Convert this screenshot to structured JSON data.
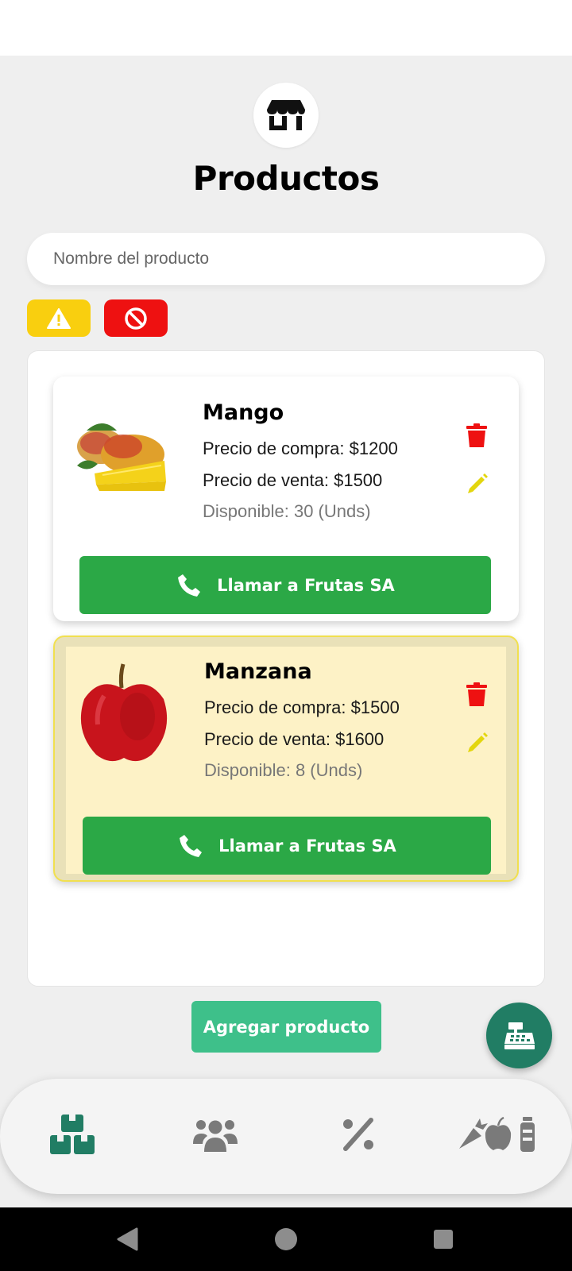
{
  "header": {
    "title": "Productos",
    "store_icon": "store-icon"
  },
  "search": {
    "placeholder": "Nombre del producto",
    "value": ""
  },
  "filters": [
    {
      "name": "warning-filter",
      "icon": "warning-icon",
      "color": "#f9cf0f"
    },
    {
      "name": "blocked-filter",
      "icon": "blocked-icon",
      "color": "#ee1111"
    }
  ],
  "products": [
    {
      "name": "Mango",
      "purchase": "Precio de compra: $1200",
      "sale": "Precio de venta: $1500",
      "stock": "Disponible: 30 (Unds)",
      "call": "Llamar a Frutas SA",
      "low_stock": false
    },
    {
      "name": "Manzana",
      "purchase": "Precio de compra: $1500",
      "sale": "Precio de venta: $1600",
      "stock": "Disponible: 8 (Unds)",
      "call": "Llamar a Frutas SA",
      "low_stock": true
    }
  ],
  "add_button": "Agregar producto",
  "fab_icon": "cash-register-icon",
  "bottom_nav": [
    {
      "name": "products",
      "icon": "boxes-icon",
      "active": true
    },
    {
      "name": "customers",
      "icon": "users-icon",
      "active": false
    },
    {
      "name": "discounts",
      "icon": "percent-icon",
      "active": false
    },
    {
      "name": "groceries",
      "icon": "groceries-icon",
      "active": false
    }
  ],
  "colors": {
    "accent_green": "#2ba846",
    "add_button": "#3ec08a",
    "fab": "#217d64",
    "nav_active": "#217d64",
    "nav_inactive": "#7a7a7a",
    "trash": "#ee1111",
    "pencil": "#e3d60e",
    "low_stock_bg": "#fdf2c6"
  }
}
